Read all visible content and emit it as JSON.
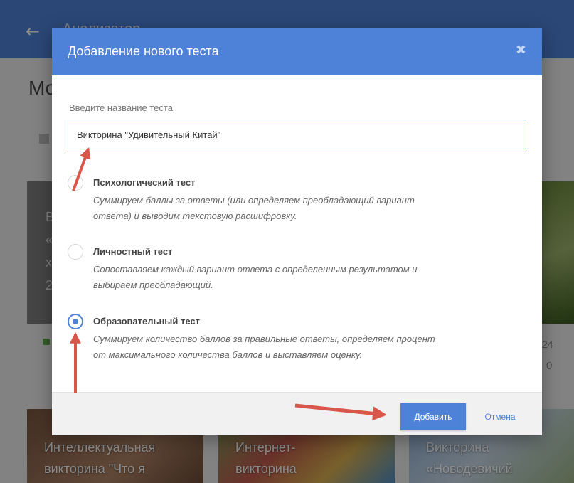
{
  "app": {
    "back_icon": "arrow-left-icon",
    "title_fragment": "Анализатор",
    "heading_fragment": "Мо",
    "left_card_fragments": [
      "В",
      "«",
      "х",
      "2"
    ],
    "right_meta_1": "24",
    "right_meta_2": "0",
    "bottom_cards": [
      {
        "line1": "Интеллектуальная",
        "line2": "викторина \"Что я"
      },
      {
        "line1": "Интернет-",
        "line2": "викторина"
      },
      {
        "line1": "Викторина",
        "line2": "«Новодевичий"
      }
    ]
  },
  "dialog": {
    "title": "Добавление нового теста",
    "close_icon": "close-icon",
    "field_label": "Введите название теста",
    "field_value": "Викторина \"Удивительный Китай\"",
    "options": [
      {
        "title": "Психологический тест",
        "desc_1": "Суммируем баллы за ответы (или определяем преобладающий вариант",
        "desc_2": "ответа) и выводим текстовую расшифровку.",
        "selected": false
      },
      {
        "title": "Личностный тест",
        "desc_1": "Сопоставляем каждый вариант ответа с определенным результатом и",
        "desc_2": "выбираем преобладающий.",
        "selected": false
      },
      {
        "title": "Образовательный тест",
        "desc_1": "Суммируем количество баллов за правильные ответы, определяем процент",
        "desc_2": "от максимального количества баллов и выставляем оценку.",
        "selected": true
      }
    ],
    "add_label": "Добавить",
    "cancel_label": "Отмена"
  },
  "colors": {
    "accent": "#4e82d8",
    "annotation_arrow": "#d9564a",
    "overlay": "#000000"
  }
}
